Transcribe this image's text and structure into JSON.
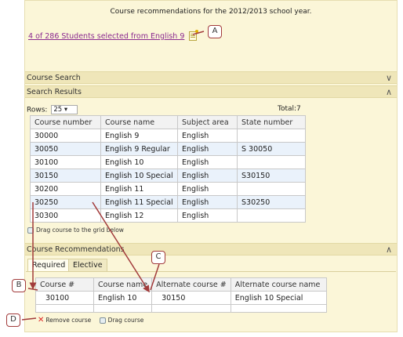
{
  "header": {
    "title": "Course recommendations for the 2012/2013 school year.",
    "selection_link": "4 of 286 Students selected from English 9"
  },
  "sections": {
    "course_search": "Course Search",
    "search_results": "Search Results",
    "course_recommendations": "Course Recommendations"
  },
  "results": {
    "rows_label": "Rows:",
    "rows_value": "25",
    "total": "Total:7",
    "columns": [
      "Course number",
      "Course name",
      "Subject area",
      "State number"
    ],
    "rows": [
      [
        "30000",
        "English 9",
        "English",
        ""
      ],
      [
        "30050",
        "English 9 Regular",
        "English",
        "S 30050"
      ],
      [
        "30100",
        "English 10",
        "English",
        ""
      ],
      [
        "30150",
        "English 10 Special",
        "English",
        "S30150"
      ],
      [
        "30200",
        "English 11",
        "English",
        ""
      ],
      [
        "30250",
        "English 11 Special",
        "English",
        "S30250"
      ],
      [
        "30300",
        "English 12",
        "English",
        ""
      ]
    ],
    "drag_hint": "Drag course to the grid below"
  },
  "recommendations": {
    "tabs": [
      "Required",
      "Elective"
    ],
    "columns": [
      "Course #",
      "Course name",
      "Alternate course #",
      "Alternate course name"
    ],
    "rows": [
      [
        "30100",
        "English 10",
        "30150",
        "English 10 Special"
      ]
    ],
    "remove_label": "Remove course",
    "drag_label": "Drag course"
  },
  "callouts": [
    "A",
    "B",
    "C",
    "D"
  ],
  "icons": {
    "note": "note-icon",
    "collapse": "chevron-down-icon",
    "expand": "chevron-up-icon",
    "drag": "drag-icon",
    "remove": "remove-x-icon"
  },
  "colors": {
    "panel_bg": "#fbf6d8",
    "section_bar": "#efe6b9",
    "link": "#8b2a8f",
    "callout_border": "#a23b3b",
    "alt_row": "#eaf2fb"
  }
}
